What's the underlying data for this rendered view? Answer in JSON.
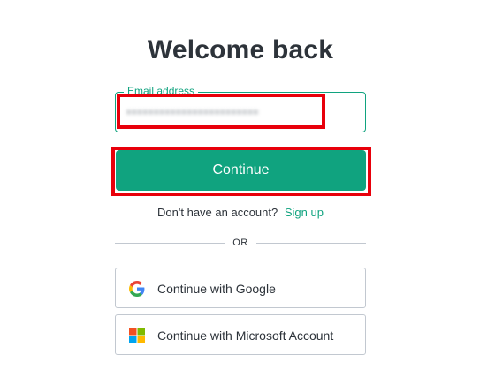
{
  "title": "Welcome back",
  "email_field": {
    "label": "Email address",
    "value": "••••••••••••••••••••••••"
  },
  "continue_button": "Continue",
  "signup": {
    "prompt": "Don't have an account?",
    "link": "Sign up"
  },
  "divider": "OR",
  "social": {
    "google": {
      "label": "Continue with Google",
      "icon": "google-icon"
    },
    "microsoft": {
      "label": "Continue with Microsoft Account",
      "icon": "microsoft-icon"
    }
  },
  "colors": {
    "accent": "#10a37f",
    "highlight": "#e8000b",
    "text": "#2d333a",
    "border": "#c2c8d0"
  }
}
